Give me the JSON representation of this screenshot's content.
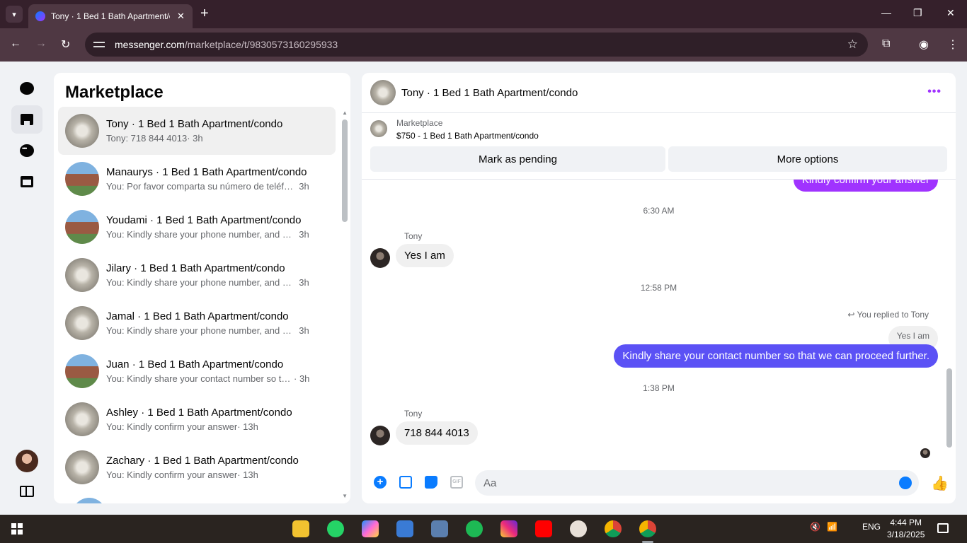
{
  "browser": {
    "tab_title": "Tony · 1 Bed 1 Bath Apartment/c",
    "url_host": "messenger.com",
    "url_path": "/marketplace/t/9830573160295933"
  },
  "sidebar": {
    "title": "Marketplace",
    "conversations": [
      {
        "name": "Tony · 1 Bed 1 Bath Apartment/condo",
        "preview": "Tony: 718 844 4013",
        "time": "· 3h"
      },
      {
        "name": "Manaurys · 1 Bed 1 Bath Apartment/condo",
        "preview": "You: Por favor comparta su número de teléfo...",
        "time": "3h"
      },
      {
        "name": "Youdami · 1 Bed 1 Bath Apartment/condo",
        "preview": "You: Kindly share your phone number, and I ...",
        "time": "3h"
      },
      {
        "name": "Jilary · 1 Bed 1 Bath Apartment/condo",
        "preview": "You: Kindly share your phone number, and I ...",
        "time": "3h"
      },
      {
        "name": "Jamal · 1 Bed 1 Bath Apartment/condo",
        "preview": "You: Kindly share your phone number, and I ...",
        "time": "3h"
      },
      {
        "name": "Juan · 1 Bed 1 Bath Apartment/condo",
        "preview": "You: Kindly share your contact number so th...",
        "time": "· 3h"
      },
      {
        "name": "Ashley · 1 Bed 1 Bath Apartment/condo",
        "preview": "You: Kindly confirm your answer",
        "time": "· 13h"
      },
      {
        "name": "Zachary · 1 Bed 1 Bath Apartment/condo",
        "preview": "You: Kindly confirm your answer",
        "time": "· 13h"
      }
    ]
  },
  "chat": {
    "title": "Tony · 1 Bed 1 Bath Apartment/condo",
    "more": "•••",
    "listing_label": "Marketplace",
    "listing_title": "$750 - 1 Bed 1 Bath Apartment/condo",
    "mark_pending": "Mark as pending",
    "more_options": "More options",
    "partial_out": "Kindly confirm your answer",
    "time_1": "6:30 AM",
    "sender_1": "Tony",
    "msg_1": "Yes I am",
    "time_2": "12:58 PM",
    "reply_note": "You replied to Tony",
    "quoted": "Yes I am",
    "msg_2": "Kindly share your contact number so that we can proceed further.",
    "time_3": "1:38 PM",
    "sender_2": "Tony",
    "msg_3": "718 844 4013",
    "composer_placeholder": "Aa"
  },
  "taskbar": {
    "lang": "ENG",
    "time": "4:44 PM",
    "date": "3/18/2025"
  },
  "colors": {
    "accent": "#0a7cff",
    "outgoing": "#5b51f5",
    "purple": "#a033ff"
  }
}
